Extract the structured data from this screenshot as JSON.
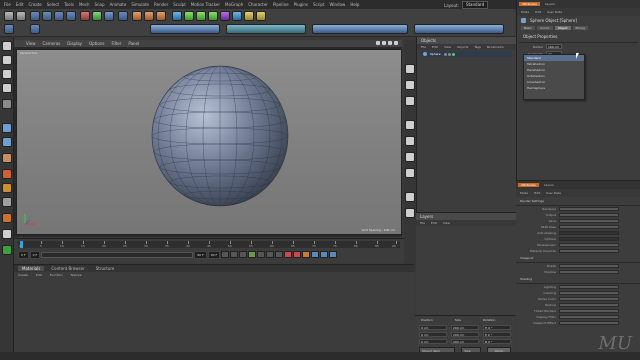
{
  "menubar": {
    "items": [
      "File",
      "Edit",
      "Create",
      "Select",
      "Tools",
      "Mesh",
      "Snap",
      "Animate",
      "Simulate",
      "Render",
      "Sculpt",
      "Motion Tracker",
      "MoGraph",
      "Character",
      "Pipeline",
      "Plugins",
      "Script",
      "Window",
      "Help"
    ],
    "layout_label": "Layout:",
    "layout_value": "Standard"
  },
  "viewport": {
    "menu": [
      "View",
      "Cameras",
      "Display",
      "Options",
      "Filter",
      "Panel"
    ],
    "label": "Perspective",
    "grid_text": "Grid Spacing : 100 cm"
  },
  "timeline": {
    "ticks": [
      "0",
      "5",
      "10",
      "15",
      "20",
      "25",
      "30",
      "35",
      "40",
      "45",
      "50",
      "55",
      "60",
      "65",
      "70",
      "75",
      "80",
      "85",
      "90"
    ],
    "start_field": "0 F",
    "current_field": "0 F",
    "end_field": "90 F",
    "end_field2": "90 F"
  },
  "materials": {
    "tabs": [
      "Materials",
      "Content Browser",
      "Structure"
    ],
    "active_tab": "Materials",
    "menu": [
      "Create",
      "Edit",
      "Function",
      "Texture"
    ]
  },
  "objects_panel": {
    "title": "Objects",
    "menu": [
      "File",
      "Edit",
      "View",
      "Objects",
      "Tags",
      "Bookmarks"
    ],
    "object_name": "Sphere",
    "layers_title": "Layers",
    "layers_menu": [
      "File",
      "Edit",
      "View"
    ]
  },
  "coordinates": {
    "headers": [
      "Position",
      "Size",
      "Rotation"
    ],
    "rows": [
      {
        "axis": "X",
        "pos": "0 cm",
        "size": "200 cm",
        "rot": "H 0 °"
      },
      {
        "axis": "Y",
        "pos": "0 cm",
        "size": "200 cm",
        "rot": "P 0 °"
      },
      {
        "axis": "Z",
        "pos": "0 cm",
        "size": "200 cm",
        "rot": "B 0 °"
      }
    ],
    "mode": "Object (Rel)",
    "size_mode": "Size",
    "apply": "Apply"
  },
  "attributes": {
    "tabs": [
      "Attributes",
      "Layers"
    ],
    "active_tab": "Attributes",
    "mode_menu": [
      "Mode",
      "Edit",
      "User Data"
    ],
    "object_title": "Sphere Object [Sphere]",
    "sub_tabs": [
      "Basic",
      "Coord.",
      "Object",
      "Phong"
    ],
    "active_sub_tab": "Object",
    "section": "Object Properties",
    "radius_label": "Radius",
    "radius_value": "100 cm",
    "segments_label": "Segments",
    "segments_value": "24",
    "type_label": "Type",
    "type_value": "Standard",
    "render_perfect_label": "Render Perfect",
    "type_options": [
      "Standard",
      "Tetrahedron",
      "Hexahedron",
      "Octahedron",
      "Icosahedron",
      "Hemisphere"
    ],
    "selected_option": "Standard"
  },
  "lower_panel": {
    "tabs": [
      "Attributes",
      "Layers"
    ],
    "mode_menu": [
      "Mode",
      "Edit",
      "User Data"
    ],
    "groups": [
      {
        "title": "Render Settings",
        "rows": [
          "Renderer",
          "Output",
          "Save",
          "Multi-Pass",
          "Anti-Aliasing",
          "Options",
          "Stereoscopic",
          "Material Override"
        ]
      },
      {
        "title": "Viewport",
        "rows": [
          "Shade",
          "Shadow"
        ]
      },
      {
        "title": "Shading",
        "rows": [
          "Lighting",
          "Coloring",
          "Vertex Color",
          "Texture",
          "Tinted Borders",
          "Display Filter",
          "Viewport Effect"
        ]
      }
    ]
  },
  "colors": {
    "accent": "#c86a28",
    "selection": "#5a6f8e",
    "button_blue": "#4a6fa5"
  },
  "watermark": "MU"
}
